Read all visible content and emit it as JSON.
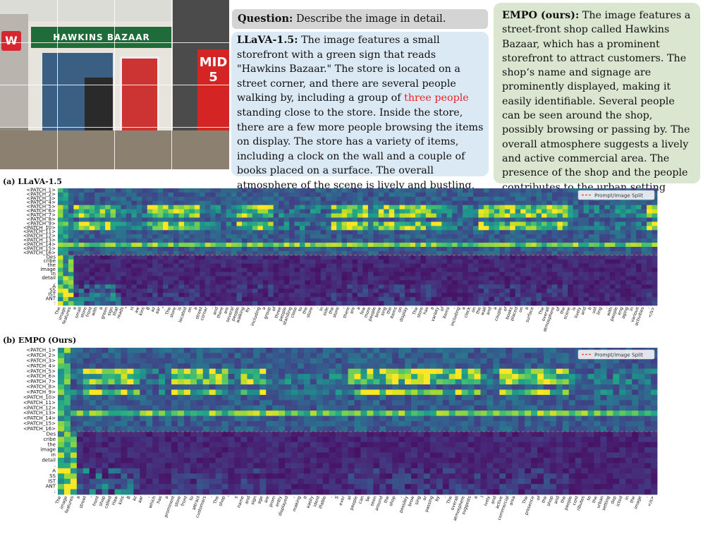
{
  "photo": {
    "sign_text": "HAWKINS BAZAAR",
    "logo_letter": "W",
    "poster_text": "MID 5"
  },
  "question": {
    "label": "Question:",
    "text": " Describe the image in detail."
  },
  "llava_answer": {
    "label": "LLaVA-1.5:",
    "text_before": " The image features a small storefront with a green sign that reads \"Hawkins Bazaar.\" The store is located on a street corner, and there are several people walking by, including a group of ",
    "highlight": "three people",
    "text_after": " standing close to the store. Inside the store, there are a few more people browsing the items on display. The store has a variety of items, including a clock on the wall and a couple of books placed on a surface. The overall atmosphere of the scene is lively and bustling, with people engaging in various activities.",
    "highlight_color": "#e8232a"
  },
  "empo_answer": {
    "label": "EMPO (ours):",
    "text": " The image features a street-front shop called Hawkins Bazaar, which has a prominent storefront to attract customers. The shop‘s name and signage are prominently displayed, making it easily identifiable. Several people can be seen around the shop, possibly browsing or passing by. The overall atmosphere suggests a lively and active commercial area. The presence of the shop and the people contributes to the urban setting depicted in the image."
  },
  "captions": {
    "a": "(a) LLaVA-1.5",
    "b": "(b) EMPO (Ours)"
  },
  "chart_data": [
    {
      "type": "heatmap",
      "title": "",
      "legend": {
        "entry": "Prompt/Image Split",
        "placement": "top-right",
        "color": "#d6453d"
      },
      "colormap": "viridis",
      "y_labels": [
        "<PATCH_1>",
        "<PATCH_2>",
        "<PATCH_3>",
        "<PATCH_4>",
        "<PATCH_5>",
        "<PATCH_6>",
        "<PATCH_7>",
        "<PATCH_8>",
        "<PATCH_9>",
        "<PATCH_10>",
        "<PATCH_11>",
        "<PATCH_12>",
        "<PATCH_13>",
        "<PATCH_14>",
        "<PATCH_15>",
        "<PATCH_16>",
        "Des",
        "cribe",
        "the",
        "image",
        "in",
        "detail",
        ".",
        "A",
        "SS",
        "IST",
        "ANT",
        ":"
      ],
      "x_labels": [
        "The",
        "image",
        "features",
        "a",
        "small",
        "store",
        "front",
        "with",
        "a",
        "green",
        "sign",
        "that",
        "reads",
        "\"",
        "H",
        "aw",
        "kins",
        "B",
        "az",
        "aar",
        ".\"",
        "The",
        "store",
        "is",
        "located",
        "on",
        "a",
        "street",
        "corner",
        ",",
        "and",
        "there",
        "are",
        "several",
        "people",
        "walking",
        "by",
        ",",
        "including",
        "a",
        "group",
        "of",
        "three",
        "people",
        "standing",
        "close",
        "to",
        "the",
        "store",
        ".",
        "In",
        "side",
        "the",
        "store",
        ",",
        "there",
        "are",
        "a",
        "few",
        "more",
        "people",
        "brow",
        "sing",
        "the",
        "items",
        "on",
        "display",
        ".",
        "The",
        "store",
        "has",
        "a",
        "variety",
        "of",
        "items",
        ",",
        "including",
        "a",
        "clock",
        "on",
        "the",
        "wall",
        "and",
        "a",
        "couple",
        "of",
        "books",
        "placed",
        "on",
        "a",
        "surface",
        ".",
        "The",
        "overall",
        "atmosphere",
        "of",
        "the",
        "scene",
        "is",
        "lively",
        "and",
        "b",
        "ust",
        "ling",
        ",",
        "with",
        "people",
        "eng",
        "aging",
        "in",
        "various",
        "activities",
        ".",
        "</s>"
      ],
      "hot_rows": [
        4,
        5,
        6,
        8,
        9,
        13
      ],
      "hot_cols": [
        [
          3,
          10
        ],
        [
          17,
          26
        ],
        [
          34,
          40
        ],
        [
          52,
          58
        ],
        [
          60,
          72
        ],
        [
          80,
          96
        ],
        [
          112,
          118
        ]
      ]
    },
    {
      "type": "heatmap",
      "title": "",
      "legend": {
        "entry": "Prompt/Image Split",
        "placement": "top-right",
        "color": "#d6453d"
      },
      "colormap": "viridis",
      "y_labels": [
        "<PATCH_1>",
        "<PATCH_2>",
        "<PATCH_3>",
        "<PATCH_4>",
        "<PATCH_5>",
        "<PATCH_6>",
        "<PATCH_7>",
        "<PATCH_8>",
        "<PATCH_9>",
        "<PATCH_10>",
        "<PATCH_11>",
        "<PATCH_12>",
        "<PATCH_13>",
        "<PATCH_14>",
        "<PATCH_15>",
        "<PATCH_16>",
        "Des",
        "cribe",
        "the",
        "image",
        "in",
        "detail",
        ".",
        "A",
        "SS",
        "IST",
        "ANT",
        ":"
      ],
      "x_labels": [
        "The",
        "image",
        "features",
        "a",
        "street",
        "-",
        "front",
        "shop",
        "called",
        "Haw",
        "kins",
        "B",
        "az",
        "aar",
        ",",
        "which",
        "has",
        "a",
        "prominent",
        "store",
        "front",
        "to",
        "attract",
        "customers",
        ".",
        "The",
        "shop",
        "'",
        "s",
        "name",
        "and",
        "sign",
        "age",
        "are",
        "prom",
        "ently",
        "displayed",
        ",",
        "making",
        "it",
        "easily",
        "ident",
        "ifiable",
        ".",
        "S",
        "ever",
        "al",
        "people",
        "can",
        "be",
        "seen",
        "around",
        "the",
        "shop",
        ",",
        "possibly",
        "brow",
        "sing",
        "or",
        "passing",
        "by",
        ".",
        "The",
        "overall",
        "atmosphere",
        "suggests",
        "a",
        "l",
        "ively",
        "and",
        "active",
        "commercial",
        "area",
        ".",
        "The",
        "presence",
        "of",
        "the",
        "shop",
        "and",
        "the",
        "people",
        "cont",
        "ributes",
        "to",
        "the",
        "urban",
        "setting",
        "dep",
        "icted",
        "in",
        "the",
        "image",
        ".",
        "</s>"
      ],
      "hot_rows": [
        4,
        5,
        6,
        8,
        12
      ],
      "hot_cols": [
        [
          4,
          12
        ],
        [
          18,
          26
        ],
        [
          29,
          32
        ],
        [
          46,
          66
        ],
        [
          70,
          80
        ]
      ]
    }
  ]
}
